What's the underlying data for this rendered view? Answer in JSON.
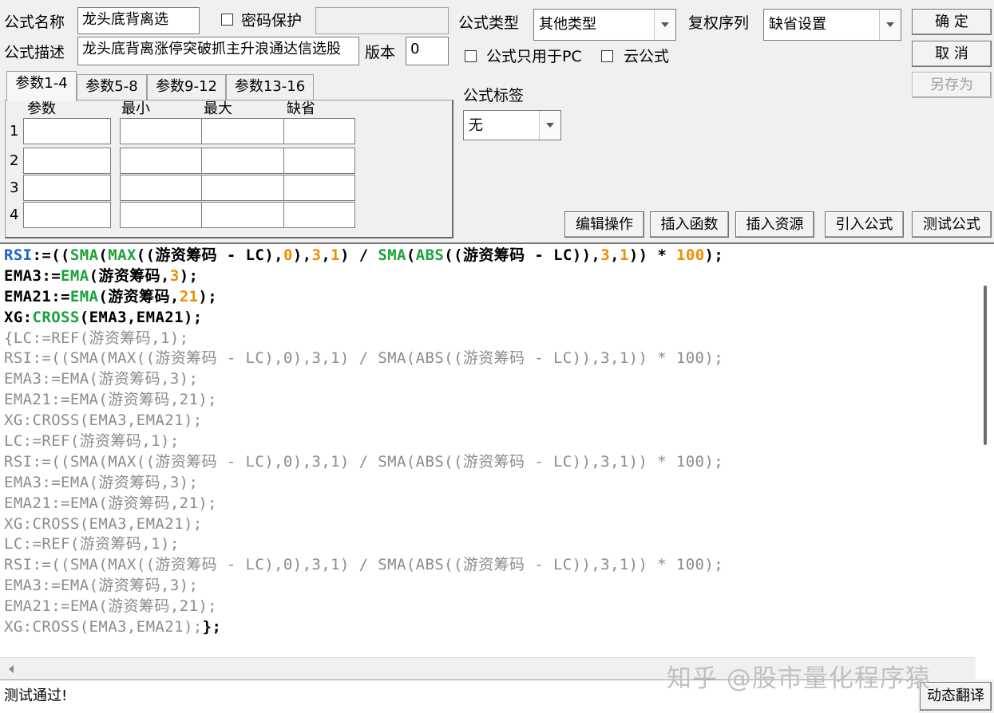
{
  "header": {
    "name_label": "公式名称",
    "name_value": "龙头底背离选",
    "password_label": "密码保护",
    "password_value": "",
    "desc_label": "公式描述",
    "desc_value": "龙头底背离涨停突破抓主升浪通达信选股",
    "version_label": "版本",
    "version_value": "0",
    "type_label": "公式类型",
    "type_value": "其他类型",
    "rights_label": "复权序列",
    "rights_value": "缺省设置",
    "pc_only_label": "公式只用于PC",
    "cloud_label": "云公式",
    "tag_label": "公式标签",
    "tag_value": "无"
  },
  "buttons": {
    "ok": "确  定",
    "cancel": "取  消",
    "save_as": "另存为",
    "edit_ops": "编辑操作",
    "insert_func": "插入函数",
    "insert_res": "插入资源",
    "import_formula": "引入公式",
    "test_formula": "测试公式",
    "dynamic_translate": "动态翻译"
  },
  "params": {
    "tabs": [
      "参数1-4",
      "参数5-8",
      "参数9-12",
      "参数13-16"
    ],
    "active_tab": 0,
    "columns": [
      "参数",
      "最小",
      "最大",
      "缺省"
    ],
    "rows": [
      "1",
      "2",
      "3",
      "4"
    ]
  },
  "code_lines": [
    [
      {
        "t": "RSI",
        "c": "b"
      },
      {
        "t": ":=((",
        "c": ""
      },
      {
        "t": "SMA",
        "c": "f"
      },
      {
        "t": "(",
        "c": ""
      },
      {
        "t": "MAX",
        "c": "f"
      },
      {
        "t": "((游资筹码 - LC),",
        "c": ""
      },
      {
        "t": "0",
        "c": "n"
      },
      {
        "t": "),",
        "c": ""
      },
      {
        "t": "3",
        "c": "n"
      },
      {
        "t": ",",
        "c": ""
      },
      {
        "t": "1",
        "c": "n"
      },
      {
        "t": ") / ",
        "c": ""
      },
      {
        "t": "SMA",
        "c": "f"
      },
      {
        "t": "(",
        "c": ""
      },
      {
        "t": "ABS",
        "c": "f"
      },
      {
        "t": "((游资筹码 - LC)),",
        "c": ""
      },
      {
        "t": "3",
        "c": "n"
      },
      {
        "t": ",",
        "c": ""
      },
      {
        "t": "1",
        "c": "n"
      },
      {
        "t": ")) * ",
        "c": ""
      },
      {
        "t": "100",
        "c": "n"
      },
      {
        "t": ");",
        "c": ""
      }
    ],
    [
      {
        "t": "EMA3:=",
        "c": ""
      },
      {
        "t": "EMA",
        "c": "f"
      },
      {
        "t": "(游资筹码,",
        "c": ""
      },
      {
        "t": "3",
        "c": "n"
      },
      {
        "t": ");",
        "c": ""
      }
    ],
    [
      {
        "t": "EMA21:=",
        "c": ""
      },
      {
        "t": "EMA",
        "c": "f"
      },
      {
        "t": "(游资筹码,",
        "c": ""
      },
      {
        "t": "21",
        "c": "n"
      },
      {
        "t": ");",
        "c": ""
      }
    ],
    [
      {
        "t": "XG:",
        "c": ""
      },
      {
        "t": "CROSS",
        "c": "f"
      },
      {
        "t": "(EMA3,EMA21);",
        "c": ""
      }
    ],
    [
      {
        "t": "{LC:=REF(游资筹码,1);",
        "c": "cm"
      }
    ],
    [
      {
        "t": "RSI:=((SMA(MAX((游资筹码 - LC),0),3,1) / SMA(ABS((游资筹码 - LC)),3,1)) * 100);",
        "c": "cm"
      }
    ],
    [
      {
        "t": "EMA3:=EMA(游资筹码,3);",
        "c": "cm"
      }
    ],
    [
      {
        "t": "EMA21:=EMA(游资筹码,21);",
        "c": "cm"
      }
    ],
    [
      {
        "t": "XG:CROSS(EMA3,EMA21);",
        "c": "cm"
      }
    ],
    [
      {
        "t": "LC:=REF(游资筹码,1);",
        "c": "cm"
      }
    ],
    [
      {
        "t": "RSI:=((SMA(MAX((游资筹码 - LC),0),3,1) / SMA(ABS((游资筹码 - LC)),3,1)) * 100);",
        "c": "cm"
      }
    ],
    [
      {
        "t": "EMA3:=EMA(游资筹码,3);",
        "c": "cm"
      }
    ],
    [
      {
        "t": "EMA21:=EMA(游资筹码,21);",
        "c": "cm"
      }
    ],
    [
      {
        "t": "XG:CROSS(EMA3,EMA21);",
        "c": "cm"
      }
    ],
    [
      {
        "t": "LC:=REF(游资筹码,1);",
        "c": "cm"
      }
    ],
    [
      {
        "t": "RSI:=((SMA(MAX((游资筹码 - LC),0),3,1) / SMA(ABS((游资筹码 - LC)),3,1)) * 100);",
        "c": "cm"
      }
    ],
    [
      {
        "t": "EMA3:=EMA(游资筹码,3);",
        "c": "cm"
      }
    ],
    [
      {
        "t": "EMA21:=EMA(游资筹码,21);",
        "c": "cm"
      }
    ],
    [
      {
        "t": "XG:CROSS(EMA3,EMA21);",
        "c": "cm"
      },
      {
        "t": "};",
        "c": ""
      }
    ]
  ],
  "status_text": "测试通过!",
  "watermark": "知乎 @股市量化程序猿",
  "colors": {
    "function": "#1aa33a",
    "number": "#f08c00",
    "variable": "#1a62c8",
    "comment": "#8c8c8c"
  }
}
